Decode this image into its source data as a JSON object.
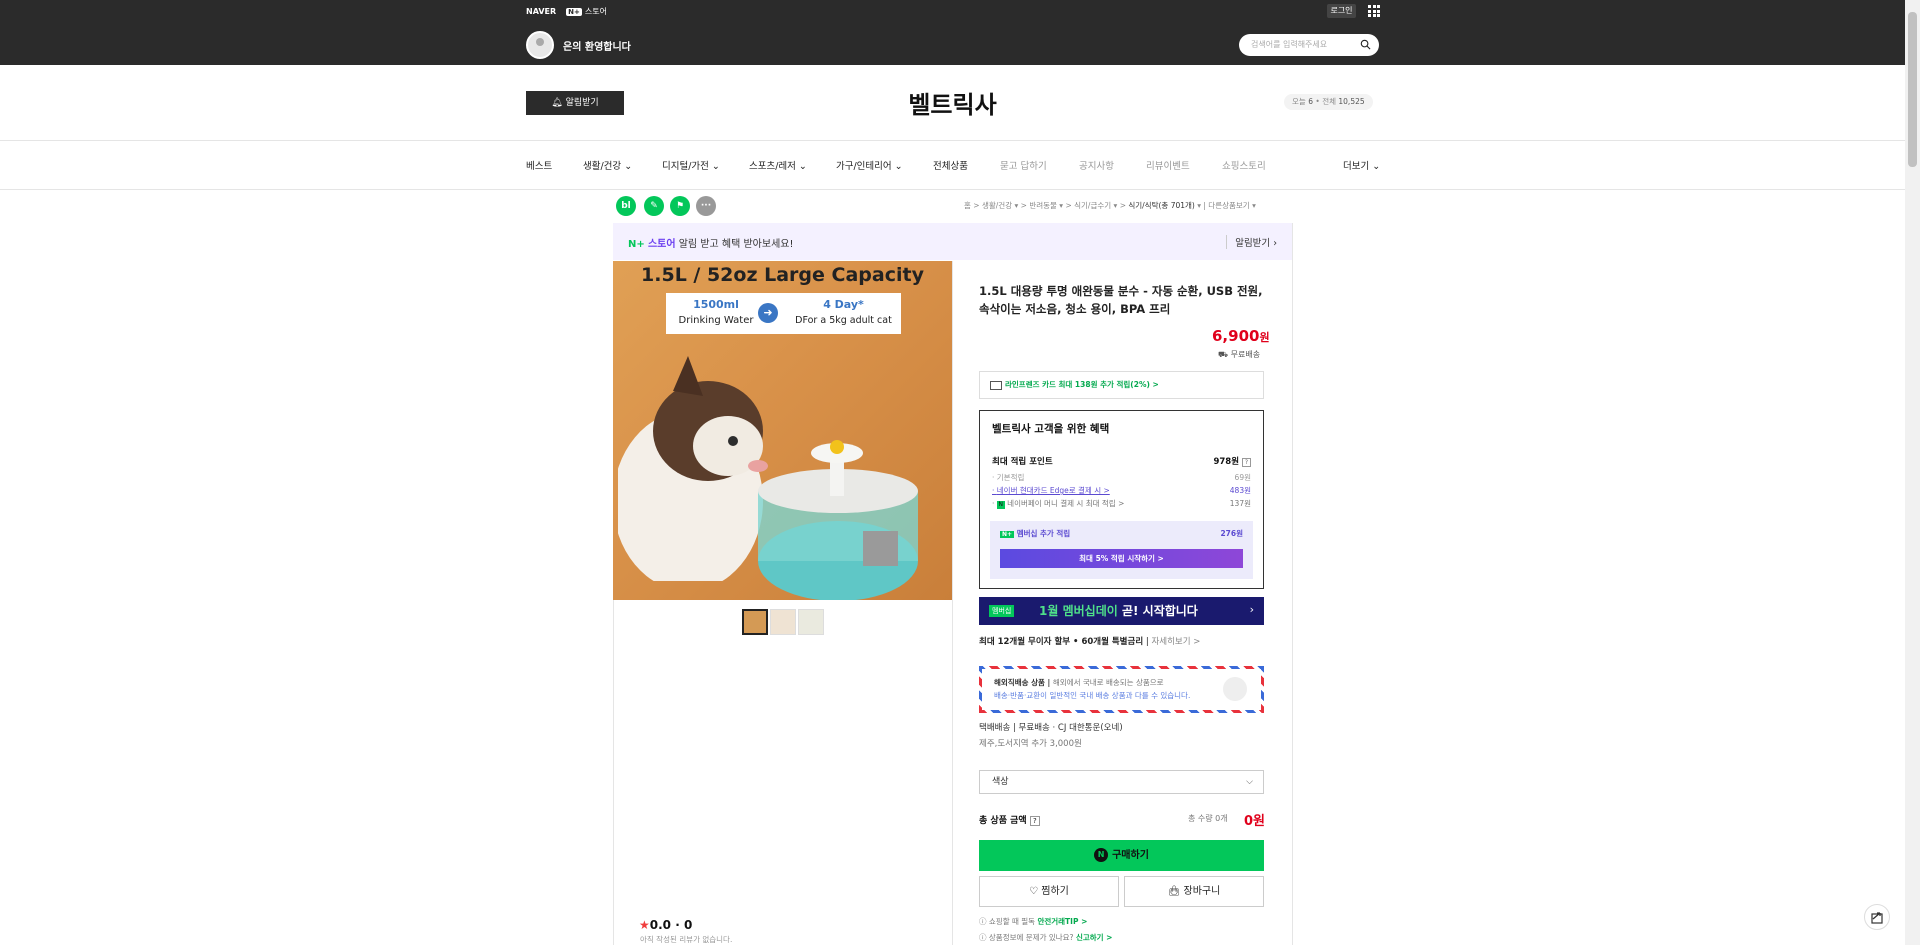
{
  "topbar": {
    "naver": "NAVER",
    "nplus_store": "스토어",
    "login": "로그인",
    "welcome": "은의 환영합니다",
    "search_placeholder": "검색어를 입력해주세요"
  },
  "header": {
    "alarm": "알림받기",
    "store_name": "벨트릭사",
    "visit_today_label": "오늘",
    "visit_today": "6",
    "visit_total_label": "전체",
    "visit_total": "10,525"
  },
  "nav": {
    "items": [
      "베스트",
      "생활/건강",
      "디지털/가전",
      "스포츠/레저",
      "가구/인테리어",
      "전체상품",
      "묻고 답하기",
      "공지사항",
      "리뷰이벤트",
      "쇼핑스토리"
    ],
    "more": "더보기"
  },
  "breadcrumb": {
    "items": [
      "홈",
      "생활/건강",
      "반려동물",
      "식기/급수기",
      "식기/식탁(총 701개)"
    ],
    "extra": "다른상품보기"
  },
  "promo": {
    "text": "알림 받고 혜택 받아보세요!",
    "store": "스토어",
    "action": "알림받기"
  },
  "image": {
    "title": "1.5L / 52oz Large Capacity",
    "left_top": "1500ml",
    "left_bottom": "Drinking Water",
    "right_top": "4 Day*",
    "right_bottom": "DFor a 5kg adult cat"
  },
  "product": {
    "title": "1.5L 대용량 투명 애완동물 분수 - 자동 순환, USB 전원, 속삭이는 저소음, 청소 용이, BPA 프리",
    "price": "6,900",
    "price_unit": "원",
    "shipping": "무료배송",
    "card_benefit": "라인프렌즈 카드 최대 138원 추가 적립(2%) >"
  },
  "benefit": {
    "title": "벨트릭사 고객을 위한 혜택",
    "max_label": "최대 적립 포인트",
    "max_value": "978원",
    "basic_label": "기본적립",
    "basic_value": "69원",
    "card_label": "네이버 현대카드 Edge로 결제 시 >",
    "card_value": "483원",
    "pay_label": "네이버페이 머니 결제 시 최대 적립 >",
    "pay_value": "137원",
    "member_label": "멤버십 추가 적립",
    "member_value": "276원",
    "member_btn": "최대 5% 적립 시작하기 >"
  },
  "banner": {
    "badge": "멤버십",
    "highlight": "1월 멤버십데이",
    "rest": " 곧! 시작합니다"
  },
  "installment": {
    "text": "최대 12개월 무이자 할부 • 60개월 특별금리",
    "more": "자세히보기 >"
  },
  "overseas": {
    "title": "해외직배송 상품",
    "desc": "해외에서 국내로 배송되는 상품으로",
    "desc2": "배송·반품·교환이 일반적인 국내 배송 상품과 다를 수 있습니다."
  },
  "delivery": {
    "line1": "택배배송 | 무료배송 · CJ 대한통운(오네)",
    "line2": "제주,도서지역 추가 3,000원"
  },
  "option": {
    "placeholder": "색상"
  },
  "total": {
    "label": "총 상품 금액",
    "qty": "총 수량 0개",
    "amount": "0원"
  },
  "buttons": {
    "buy": "구매하기",
    "wish": "찜하기",
    "cart": "장바구니"
  },
  "tips": {
    "t1": "쇼핑할 때 필독",
    "t1b": "안전거래TIP >",
    "t2": "상품정보에 문제가 있나요?",
    "t2b": "신고하기 >"
  },
  "review": {
    "score": "0.0",
    "count": "0",
    "empty": "아직 작성된 리뷰가 없습니다."
  }
}
